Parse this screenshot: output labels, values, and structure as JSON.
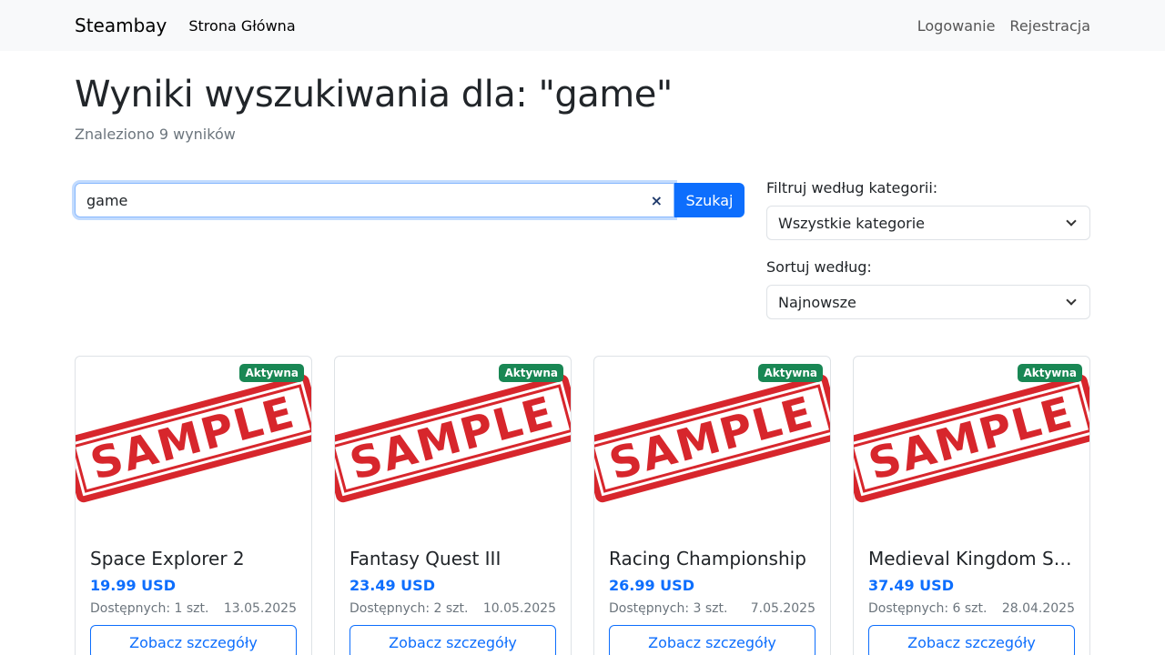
{
  "navbar": {
    "brand": "Steambay",
    "home": "Strona Główna",
    "login": "Logowanie",
    "register": "Rejestracja"
  },
  "header": {
    "title": "Wyniki wyszukiwania dla: \"game\"",
    "subtitle": "Znaleziono 9 wyników"
  },
  "search": {
    "value": "game",
    "button": "Szukaj",
    "clear_icon": "×"
  },
  "filters": {
    "category_label": "Filtruj według kategorii:",
    "category_value": "Wszystkie kategorie",
    "sort_label": "Sortuj według:",
    "sort_value": "Najnowsze"
  },
  "cards": [
    {
      "badge": "Aktywna",
      "title": "Space Explorer 2",
      "price": "19.99 USD",
      "stock": "Dostępnych: 1 szt.",
      "date": "13.05.2025",
      "button": "Zobacz szczegóły",
      "image_text": "SAMPLE"
    },
    {
      "badge": "Aktywna",
      "title": "Fantasy Quest III",
      "price": "23.49 USD",
      "stock": "Dostępnych: 2 szt.",
      "date": "10.05.2025",
      "button": "Zobacz szczegóły",
      "image_text": "SAMPLE"
    },
    {
      "badge": "Aktywna",
      "title": "Racing Championship",
      "price": "26.99 USD",
      "stock": "Dostępnych: 3 szt.",
      "date": "7.05.2025",
      "button": "Zobacz szczegóły",
      "image_text": "SAMPLE"
    },
    {
      "badge": "Aktywna",
      "title": "Medieval Kingdom Si...",
      "price": "37.49 USD",
      "stock": "Dostępnych: 6 szt.",
      "date": "28.04.2025",
      "button": "Zobacz szczegóły",
      "image_text": "SAMPLE"
    }
  ]
}
